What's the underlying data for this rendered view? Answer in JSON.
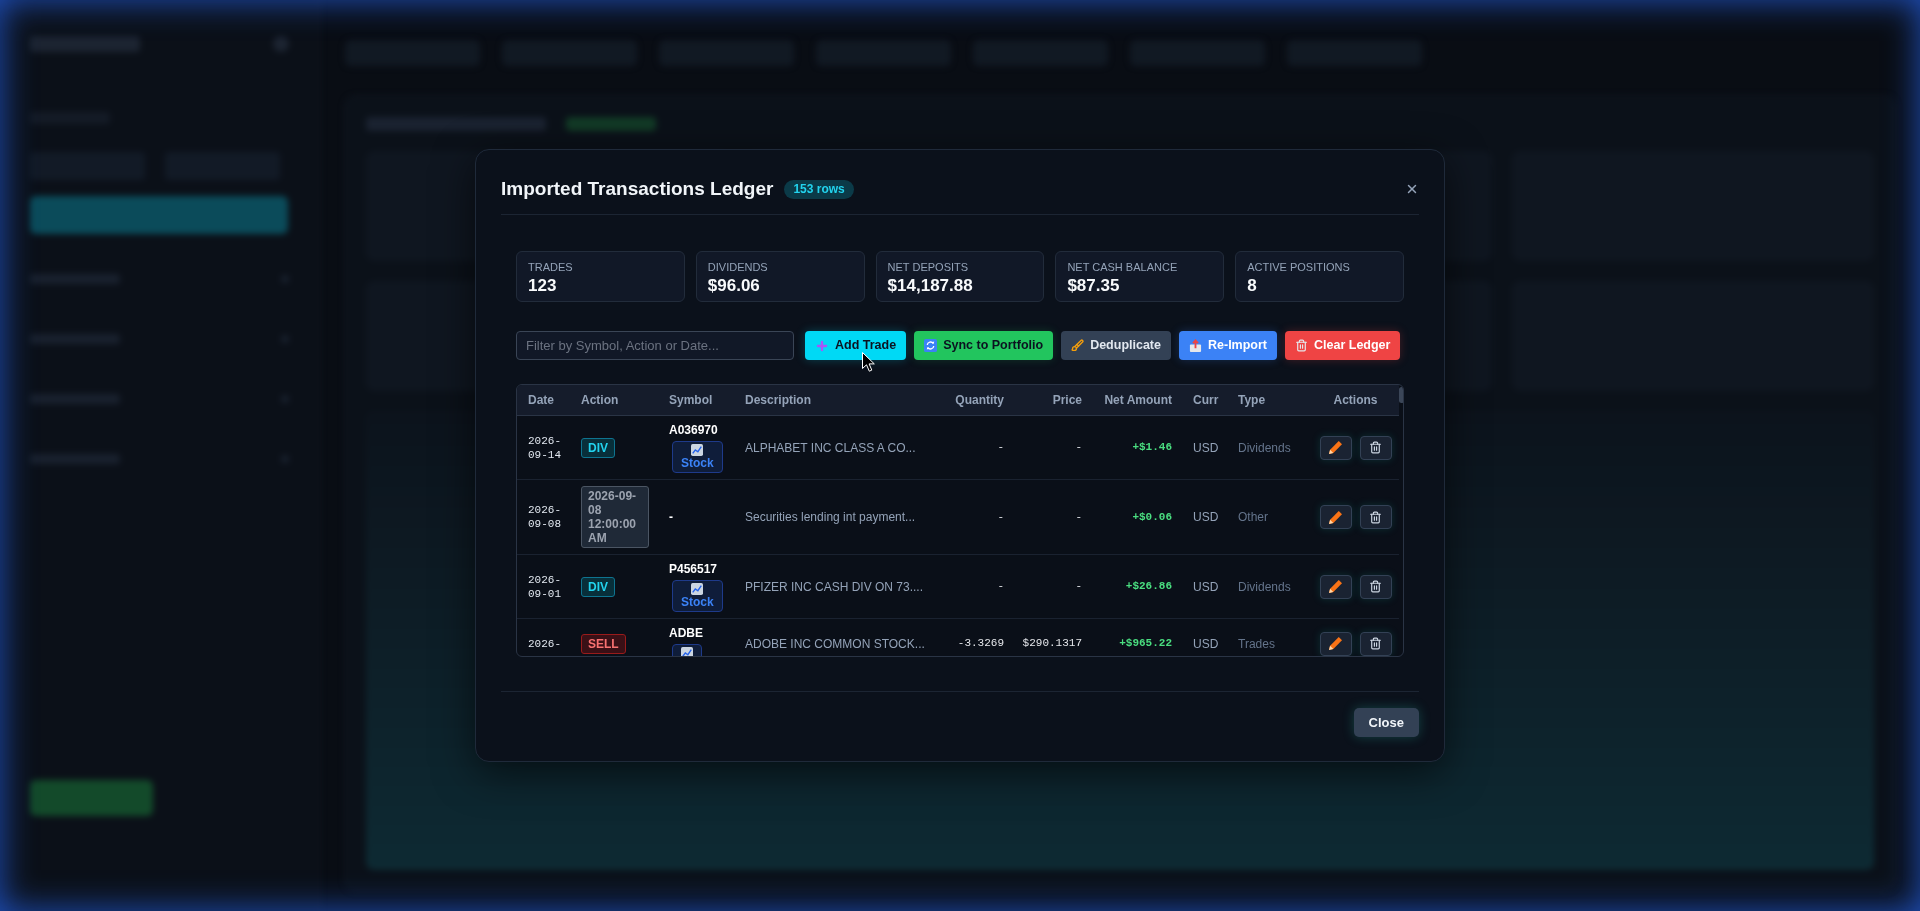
{
  "dialog": {
    "title": "Imported Transactions Ledger",
    "row_count": "153 rows"
  },
  "stats": [
    {
      "label": "TRADES",
      "value": "123"
    },
    {
      "label": "DIVIDENDS",
      "value": "$96.06"
    },
    {
      "label": "NET DEPOSITS",
      "value": "$14,187.88"
    },
    {
      "label": "NET CASH BALANCE",
      "value": "$87.35"
    },
    {
      "label": "ACTIVE POSITIONS",
      "value": "8"
    }
  ],
  "filter": {
    "placeholder": "Filter by Symbol, Action or Date..."
  },
  "toolbar": [
    {
      "label": "Add Trade",
      "kind": "add"
    },
    {
      "label": "Sync to Portfolio",
      "kind": "sync"
    },
    {
      "label": "Deduplicate",
      "kind": "dedupe"
    },
    {
      "label": "Re-Import",
      "kind": "reimport"
    },
    {
      "label": "Clear Ledger",
      "kind": "clear"
    }
  ],
  "table": {
    "columns": [
      "Date",
      "Action",
      "Symbol",
      "Description",
      "Quantity",
      "Price",
      "Net Amount",
      "Curr",
      "Type",
      "Actions"
    ],
    "rows": [
      {
        "date": "2026-09-14",
        "action": {
          "label": "DIV",
          "kind": "dividend"
        },
        "symbol": "A036970",
        "asset_badge": {
          "kind": "stock",
          "label": "Stock"
        },
        "description": "ALPHABET INC CLASS A CO...",
        "quantity": "-",
        "price": "-",
        "net_amount": "+$1.46",
        "currency": "USD",
        "type": "Dividends"
      },
      {
        "date": "2026-09-08",
        "action": {
          "label": "2026-09-08 12:00:00 AM",
          "kind": "other"
        },
        "symbol": "-",
        "description": "Securities lending int payment...",
        "quantity": "-",
        "price": "-",
        "net_amount": "+$0.06",
        "currency": "USD",
        "type": "Other"
      },
      {
        "date": "2026-09-01",
        "action": {
          "label": "DIV",
          "kind": "dividend"
        },
        "symbol": "P456517",
        "asset_badge": {
          "kind": "stock",
          "label": "Stock"
        },
        "description": "PFIZER INC CASH DIV ON 73....",
        "quantity": "-",
        "price": "-",
        "net_amount": "+$26.86",
        "currency": "USD",
        "type": "Dividends"
      },
      {
        "date": "2026-",
        "action": {
          "label": "SELL",
          "kind": "sell"
        },
        "symbol": "ADBE",
        "asset_badge": {
          "kind": "stock"
        },
        "description": "ADOBE INC COMMON STOCK...",
        "quantity": "-3.3269",
        "price": "$290.1317",
        "net_amount": "+$965.22",
        "currency": "USD",
        "type": "Trades"
      }
    ]
  },
  "footer": {
    "close_button": "Close"
  }
}
